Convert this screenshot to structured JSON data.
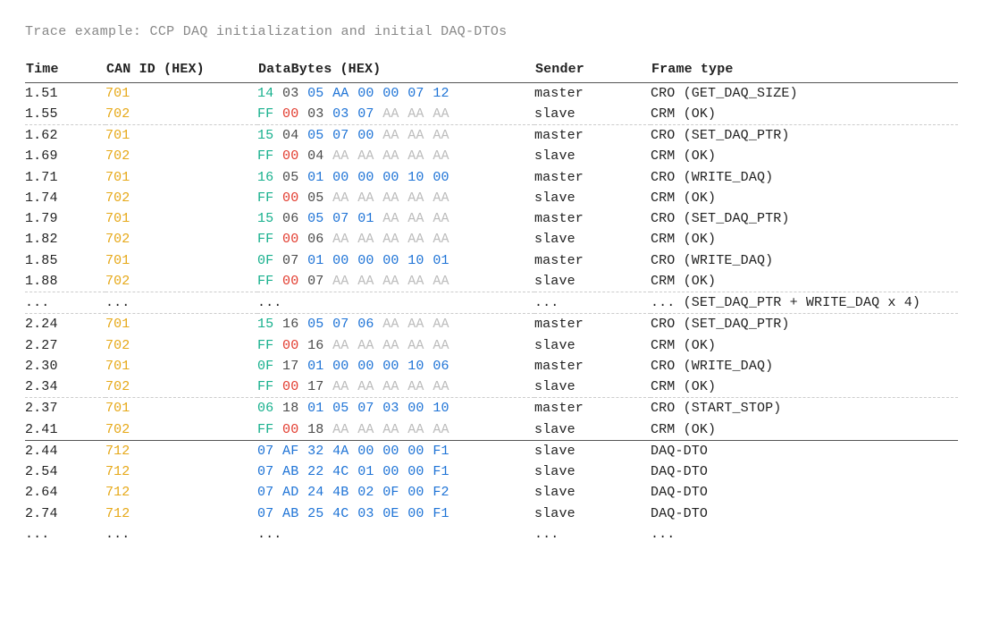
{
  "title": "Trace example: CCP DAQ initialization and initial DAQ-DTOs",
  "headers": {
    "time": "Time",
    "canid": "CAN ID (HEX)",
    "bytes": "DataBytes (HEX)",
    "sender": "Sender",
    "ftype": "Frame type"
  },
  "byte_colors": {
    "g": "#17b08d",
    "r": "#e23b2e",
    "b": "#1e73d6",
    "d": "#4a4a4a",
    "x": "#bcbcbc"
  },
  "rows": [
    {
      "time": "1.51",
      "canid": "701",
      "bytes": [
        [
          "14",
          "g"
        ],
        [
          "03",
          "d"
        ],
        [
          "05",
          "b"
        ],
        [
          "AA",
          "b"
        ],
        [
          "00",
          "b"
        ],
        [
          "00",
          "b"
        ],
        [
          "07",
          "b"
        ],
        [
          "12",
          "b"
        ]
      ],
      "sender": "master",
      "ftype": "CRO (GET_DAQ_SIZE)",
      "sep": ""
    },
    {
      "time": "1.55",
      "canid": "702",
      "bytes": [
        [
          "FF",
          "g"
        ],
        [
          "00",
          "r"
        ],
        [
          "03",
          "d"
        ],
        [
          "03",
          "b"
        ],
        [
          "07",
          "b"
        ],
        [
          "AA",
          "x"
        ],
        [
          "AA",
          "x"
        ],
        [
          "AA",
          "x"
        ]
      ],
      "sender": "slave",
      "ftype": "CRM (OK)",
      "sep": "dashed"
    },
    {
      "time": "1.62",
      "canid": "701",
      "bytes": [
        [
          "15",
          "g"
        ],
        [
          "04",
          "d"
        ],
        [
          "05",
          "b"
        ],
        [
          "07",
          "b"
        ],
        [
          "00",
          "b"
        ],
        [
          "AA",
          "x"
        ],
        [
          "AA",
          "x"
        ],
        [
          "AA",
          "x"
        ]
      ],
      "sender": "master",
      "ftype": "CRO (SET_DAQ_PTR)",
      "sep": ""
    },
    {
      "time": "1.69",
      "canid": "702",
      "bytes": [
        [
          "FF",
          "g"
        ],
        [
          "00",
          "r"
        ],
        [
          "04",
          "d"
        ],
        [
          "AA",
          "x"
        ],
        [
          "AA",
          "x"
        ],
        [
          "AA",
          "x"
        ],
        [
          "AA",
          "x"
        ],
        [
          "AA",
          "x"
        ]
      ],
      "sender": "slave",
      "ftype": "CRM (OK)",
      "sep": ""
    },
    {
      "time": "1.71",
      "canid": "701",
      "bytes": [
        [
          "16",
          "g"
        ],
        [
          "05",
          "d"
        ],
        [
          "01",
          "b"
        ],
        [
          "00",
          "b"
        ],
        [
          "00",
          "b"
        ],
        [
          "00",
          "b"
        ],
        [
          "10",
          "b"
        ],
        [
          "00",
          "b"
        ]
      ],
      "sender": "master",
      "ftype": "CRO (WRITE_DAQ)",
      "sep": ""
    },
    {
      "time": "1.74",
      "canid": "702",
      "bytes": [
        [
          "FF",
          "g"
        ],
        [
          "00",
          "r"
        ],
        [
          "05",
          "d"
        ],
        [
          "AA",
          "x"
        ],
        [
          "AA",
          "x"
        ],
        [
          "AA",
          "x"
        ],
        [
          "AA",
          "x"
        ],
        [
          "AA",
          "x"
        ]
      ],
      "sender": "slave",
      "ftype": "CRM (OK)",
      "sep": ""
    },
    {
      "time": "1.79",
      "canid": "701",
      "bytes": [
        [
          "15",
          "g"
        ],
        [
          "06",
          "d"
        ],
        [
          "05",
          "b"
        ],
        [
          "07",
          "b"
        ],
        [
          "01",
          "b"
        ],
        [
          "AA",
          "x"
        ],
        [
          "AA",
          "x"
        ],
        [
          "AA",
          "x"
        ]
      ],
      "sender": "master",
      "ftype": "CRO (SET_DAQ_PTR)",
      "sep": ""
    },
    {
      "time": "1.82",
      "canid": "702",
      "bytes": [
        [
          "FF",
          "g"
        ],
        [
          "00",
          "r"
        ],
        [
          "06",
          "d"
        ],
        [
          "AA",
          "x"
        ],
        [
          "AA",
          "x"
        ],
        [
          "AA",
          "x"
        ],
        [
          "AA",
          "x"
        ],
        [
          "AA",
          "x"
        ]
      ],
      "sender": "slave",
      "ftype": "CRM (OK)",
      "sep": ""
    },
    {
      "time": "1.85",
      "canid": "701",
      "bytes": [
        [
          "0F",
          "g"
        ],
        [
          "07",
          "d"
        ],
        [
          "01",
          "b"
        ],
        [
          "00",
          "b"
        ],
        [
          "00",
          "b"
        ],
        [
          "00",
          "b"
        ],
        [
          "10",
          "b"
        ],
        [
          "01",
          "b"
        ]
      ],
      "sender": "master",
      "ftype": "CRO (WRITE_DAQ)",
      "sep": ""
    },
    {
      "time": "1.88",
      "canid": "702",
      "bytes": [
        [
          "FF",
          "g"
        ],
        [
          "00",
          "r"
        ],
        [
          "07",
          "d"
        ],
        [
          "AA",
          "x"
        ],
        [
          "AA",
          "x"
        ],
        [
          "AA",
          "x"
        ],
        [
          "AA",
          "x"
        ],
        [
          "AA",
          "x"
        ]
      ],
      "sender": "slave",
      "ftype": "CRM (OK)",
      "sep": "dashed"
    },
    {
      "time": "...",
      "canid": "...",
      "bytes_raw": "...",
      "sender": "...",
      "ftype": "... (SET_DAQ_PTR + WRITE_DAQ x 4)",
      "sep": "dashed",
      "ellipsis": true
    },
    {
      "time": "2.24",
      "canid": "701",
      "bytes": [
        [
          "15",
          "g"
        ],
        [
          "16",
          "d"
        ],
        [
          "05",
          "b"
        ],
        [
          "07",
          "b"
        ],
        [
          "06",
          "b"
        ],
        [
          "AA",
          "x"
        ],
        [
          "AA",
          "x"
        ],
        [
          "AA",
          "x"
        ]
      ],
      "sender": "master",
      "ftype": "CRO (SET_DAQ_PTR)",
      "sep": ""
    },
    {
      "time": "2.27",
      "canid": "702",
      "bytes": [
        [
          "FF",
          "g"
        ],
        [
          "00",
          "r"
        ],
        [
          "16",
          "d"
        ],
        [
          "AA",
          "x"
        ],
        [
          "AA",
          "x"
        ],
        [
          "AA",
          "x"
        ],
        [
          "AA",
          "x"
        ],
        [
          "AA",
          "x"
        ]
      ],
      "sender": "slave",
      "ftype": "CRM (OK)",
      "sep": ""
    },
    {
      "time": "2.30",
      "canid": "701",
      "bytes": [
        [
          "0F",
          "g"
        ],
        [
          "17",
          "d"
        ],
        [
          "01",
          "b"
        ],
        [
          "00",
          "b"
        ],
        [
          "00",
          "b"
        ],
        [
          "00",
          "b"
        ],
        [
          "10",
          "b"
        ],
        [
          "06",
          "b"
        ]
      ],
      "sender": "master",
      "ftype": "CRO (WRITE_DAQ)",
      "sep": ""
    },
    {
      "time": "2.34",
      "canid": "702",
      "bytes": [
        [
          "FF",
          "g"
        ],
        [
          "00",
          "r"
        ],
        [
          "17",
          "d"
        ],
        [
          "AA",
          "x"
        ],
        [
          "AA",
          "x"
        ],
        [
          "AA",
          "x"
        ],
        [
          "AA",
          "x"
        ],
        [
          "AA",
          "x"
        ]
      ],
      "sender": "slave",
      "ftype": "CRM (OK)",
      "sep": "dashed"
    },
    {
      "time": "2.37",
      "canid": "701",
      "bytes": [
        [
          "06",
          "g"
        ],
        [
          "18",
          "d"
        ],
        [
          "01",
          "b"
        ],
        [
          "05",
          "b"
        ],
        [
          "07",
          "b"
        ],
        [
          "03",
          "b"
        ],
        [
          "00",
          "b"
        ],
        [
          "10",
          "b"
        ]
      ],
      "sender": "master",
      "ftype": "CRO (START_STOP)",
      "sep": ""
    },
    {
      "time": "2.41",
      "canid": "702",
      "bytes": [
        [
          "FF",
          "g"
        ],
        [
          "00",
          "r"
        ],
        [
          "18",
          "d"
        ],
        [
          "AA",
          "x"
        ],
        [
          "AA",
          "x"
        ],
        [
          "AA",
          "x"
        ],
        [
          "AA",
          "x"
        ],
        [
          "AA",
          "x"
        ]
      ],
      "sender": "slave",
      "ftype": "CRM (OK)",
      "sep": "solid"
    },
    {
      "time": "2.44",
      "canid": "712",
      "bytes": [
        [
          "07",
          "b"
        ],
        [
          "AF",
          "b"
        ],
        [
          "32",
          "b"
        ],
        [
          "4A",
          "b"
        ],
        [
          "00",
          "b"
        ],
        [
          "00",
          "b"
        ],
        [
          "00",
          "b"
        ],
        [
          "F1",
          "b"
        ]
      ],
      "sender": "slave",
      "ftype": "DAQ-DTO",
      "sep": ""
    },
    {
      "time": "2.54",
      "canid": "712",
      "bytes": [
        [
          "07",
          "b"
        ],
        [
          "AB",
          "b"
        ],
        [
          "22",
          "b"
        ],
        [
          "4C",
          "b"
        ],
        [
          "01",
          "b"
        ],
        [
          "00",
          "b"
        ],
        [
          "00",
          "b"
        ],
        [
          "F1",
          "b"
        ]
      ],
      "sender": "slave",
      "ftype": "DAQ-DTO",
      "sep": ""
    },
    {
      "time": "2.64",
      "canid": "712",
      "bytes": [
        [
          "07",
          "b"
        ],
        [
          "AD",
          "b"
        ],
        [
          "24",
          "b"
        ],
        [
          "4B",
          "b"
        ],
        [
          "02",
          "b"
        ],
        [
          "0F",
          "b"
        ],
        [
          "00",
          "b"
        ],
        [
          "F2",
          "b"
        ]
      ],
      "sender": "slave",
      "ftype": "DAQ-DTO",
      "sep": ""
    },
    {
      "time": "2.74",
      "canid": "712",
      "bytes": [
        [
          "07",
          "b"
        ],
        [
          "AB",
          "b"
        ],
        [
          "25",
          "b"
        ],
        [
          "4C",
          "b"
        ],
        [
          "03",
          "b"
        ],
        [
          "0E",
          "b"
        ],
        [
          "00",
          "b"
        ],
        [
          "F1",
          "b"
        ]
      ],
      "sender": "slave",
      "ftype": "DAQ-DTO",
      "sep": ""
    },
    {
      "time": "...",
      "canid": "...",
      "bytes_raw": "...",
      "sender": "...",
      "ftype": "...",
      "sep": "",
      "ellipsis": true
    }
  ]
}
